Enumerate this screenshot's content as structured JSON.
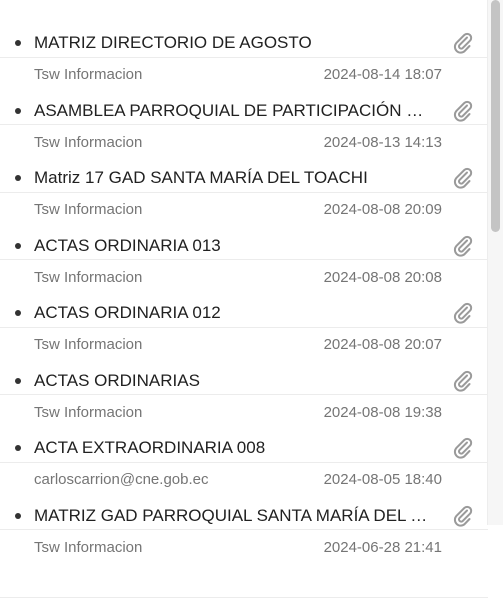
{
  "messages": [
    {
      "sender": "",
      "date": "",
      "subject": "MATRIZ DIRECTORIO DE AGOSTO"
    },
    {
      "sender": "Tsw Informacion",
      "date": "2024-08-14 18:07",
      "subject": "ASAMBLEA PARROQUIAL DE PARTICIPACIÓN CIUD…"
    },
    {
      "sender": "Tsw Informacion",
      "date": "2024-08-13 14:13",
      "subject": "Matriz 17 GAD SANTA MARÍA DEL TOACHI"
    },
    {
      "sender": "Tsw Informacion",
      "date": "2024-08-08 20:09",
      "subject": "ACTAS ORDINARIA 013"
    },
    {
      "sender": "Tsw Informacion",
      "date": "2024-08-08 20:08",
      "subject": "ACTAS ORDINARIA 012"
    },
    {
      "sender": "Tsw Informacion",
      "date": "2024-08-08 20:07",
      "subject": "ACTAS ORDINARIAS"
    },
    {
      "sender": "Tsw Informacion",
      "date": "2024-08-08 19:38",
      "subject": "ACTA EXTRAORDINARIA 008"
    },
    {
      "sender": "carloscarrion@cne.gob.ec",
      "date": "2024-08-05 18:40",
      "subject": "MATRIZ GAD PARROQUIAL SANTA MARÍA DEL TO…"
    },
    {
      "sender": "Tsw Informacion",
      "date": "2024-06-28 21:41",
      "subject": ""
    }
  ],
  "icons": {
    "attachment": "paperclip-icon"
  },
  "colors": {
    "meta_text": "#757575",
    "subject_text": "#212121",
    "icon": "#9a9a9a",
    "scroll_thumb": "#c4c4c4"
  }
}
